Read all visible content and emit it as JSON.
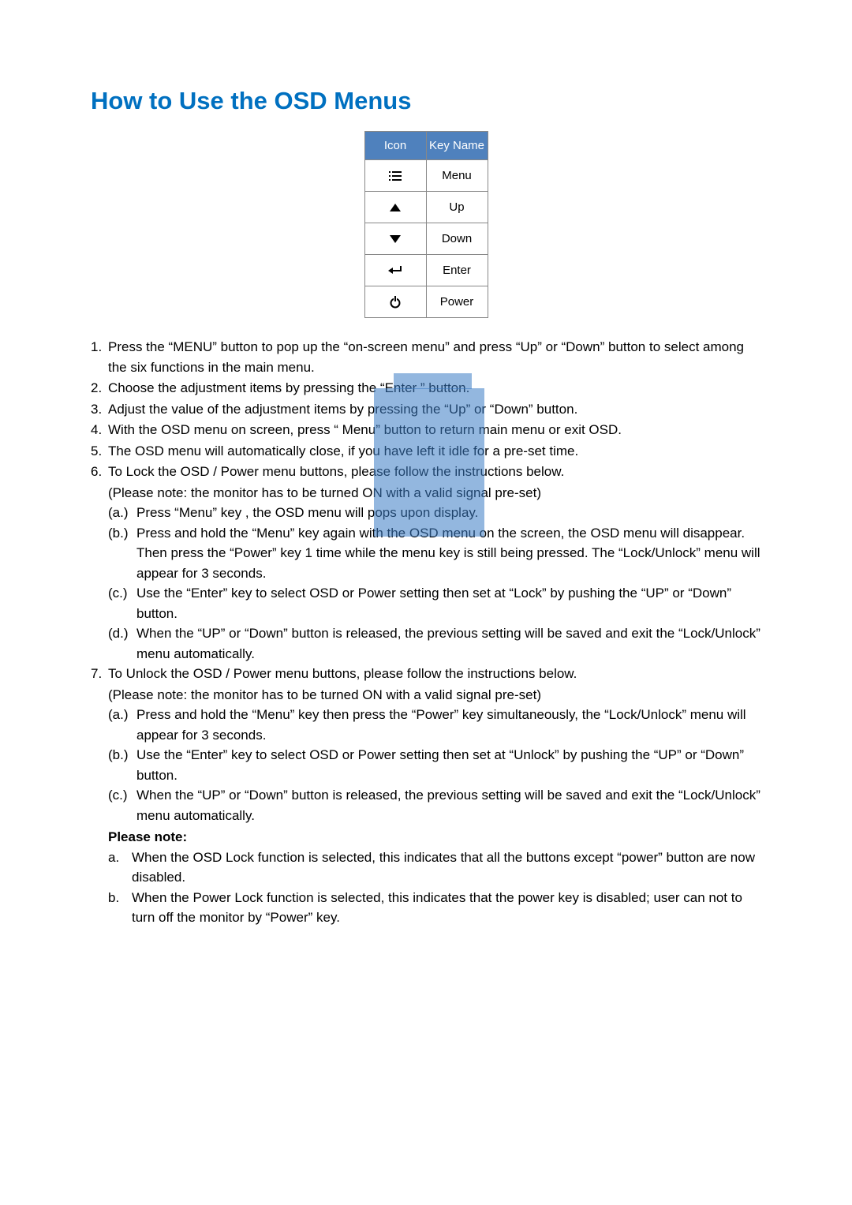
{
  "title": "How to Use the OSD Menus",
  "table": {
    "headers": {
      "icon": "Icon",
      "keyname": "Key Name"
    },
    "rows": [
      {
        "icon_name": "menu-icon",
        "key": "Menu"
      },
      {
        "icon_name": "up-icon",
        "key": "Up"
      },
      {
        "icon_name": "down-icon",
        "key": "Down"
      },
      {
        "icon_name": "enter-icon",
        "key": "Enter"
      },
      {
        "icon_name": "power-icon",
        "key": "Power"
      }
    ]
  },
  "items": [
    {
      "num": "1.",
      "text": "Press the “MENU” button to pop up the “on-screen menu” and press “Up” or “Down” button to select among the six functions in the main menu."
    },
    {
      "num": "2.",
      "text": "Choose the adjustment items by pressing the “Enter ” button."
    },
    {
      "num": "3.",
      "text": "Adjust the value of the adjustment items by pressing the “Up” or “Down” button."
    },
    {
      "num": "4.",
      "text": "With the OSD menu on screen, press “ Menu” button to return main menu or exit OSD."
    },
    {
      "num": "5.",
      "text": "The OSD menu will automatically close, if you have left it idle for a pre-set time."
    },
    {
      "num": "6.",
      "text": "To Lock the OSD / Power menu buttons, please follow the instructions below.",
      "note": "(Please note: the monitor has to be turned ON with a valid signal pre-set)",
      "subs": [
        {
          "num": "(a.)",
          "text": "Press “Menu” key , the OSD menu will pops upon display."
        },
        {
          "num": "(b.)",
          "text": "Press and hold the “Menu” key again with the OSD menu on the screen, the OSD menu will disappear. Then press the “Power” key 1 time while the menu key is still being pressed. The “Lock/Unlock” menu will appear for 3 seconds."
        },
        {
          "num": "(c.)",
          "text": "Use the “Enter” key to select OSD or Power setting then set at “Lock” by pushing the “UP” or “Down” button."
        },
        {
          "num": "(d.)",
          "text": "When the “UP” or “Down” button is released, the previous setting will be saved and exit the “Lock/Unlock” menu automatically."
        }
      ]
    },
    {
      "num": "7.",
      "text": "To Unlock the OSD / Power menu buttons, please follow the instructions below.",
      "note": "(Please note: the monitor has to be turned ON with a valid signal pre-set)",
      "subs": [
        {
          "num": "(a.)",
          "text": "Press and hold the “Menu” key then press the “Power” key simultaneously, the “Lock/Unlock” menu will appear for 3 seconds."
        },
        {
          "num": "(b.)",
          "text": "Use the “Enter” key to select OSD or Power setting then set at “Unlock” by pushing the “UP” or “Down” button."
        },
        {
          "num": "(c.)",
          "text": "When the “UP” or “Down” button is released, the previous setting will be saved and exit the “Lock/Unlock” menu automatically."
        }
      ]
    }
  ],
  "please_note": "Please note:",
  "notes": [
    {
      "num": "a.",
      "text": "When the OSD Lock function is selected, this indicates that all the buttons except “power” button are now disabled."
    },
    {
      "num": "b.",
      "text": "When the Power Lock function is selected, this indicates that the power key is disabled; user can not to turn off the monitor by “Power” key."
    }
  ]
}
